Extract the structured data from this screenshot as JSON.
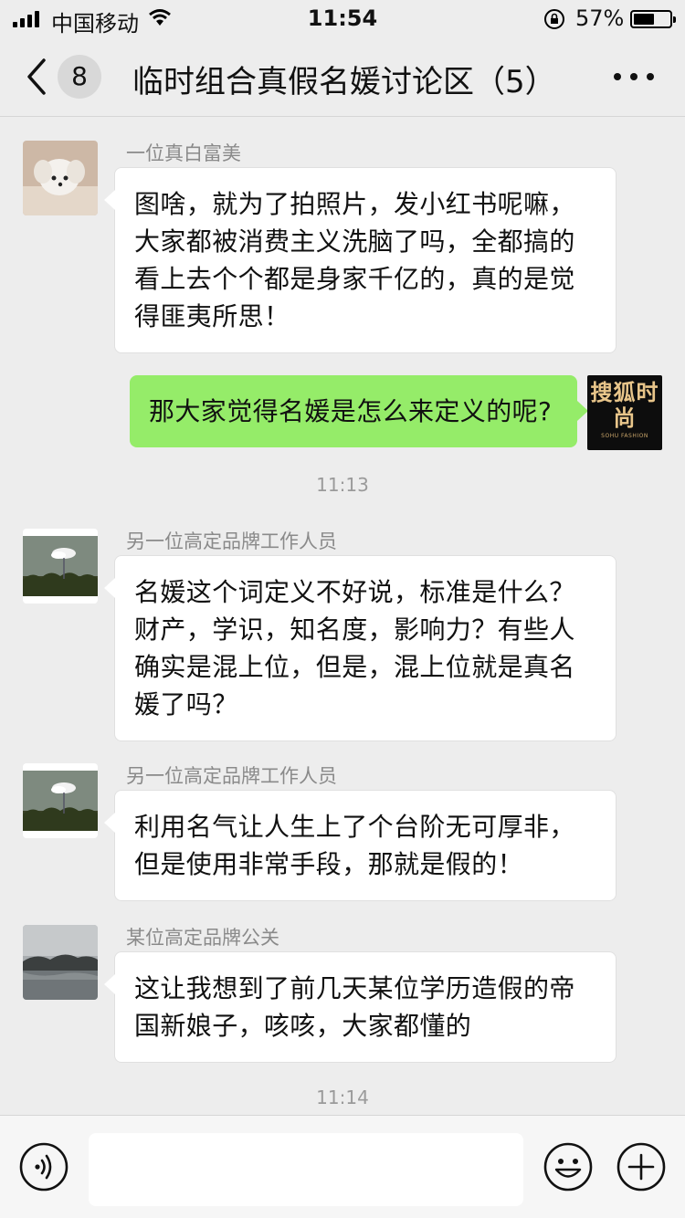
{
  "status_bar": {
    "carrier": "中国移动",
    "time": "11:54",
    "battery_text": "57%",
    "battery_level": 0.57
  },
  "header": {
    "unread_count": "8",
    "title": "临时组合真假名媛讨论区（5）"
  },
  "messages": [
    {
      "direction": "in",
      "sender": "一位真白富美",
      "avatar": "dog-avatar",
      "text": "图啥，就为了拍照片，发小红书呢嘛，大家都被消费主义洗脑了吗，全都搞的看上去个个都是身家千亿的，真的是觉得匪夷所思！"
    },
    {
      "direction": "out",
      "avatar_text": "搜狐时尚",
      "avatar_subtext": "SOHU FASHION",
      "text": "那大家觉得名媛是怎么来定义的呢?"
    },
    {
      "type": "time",
      "text": "11:13"
    },
    {
      "direction": "in",
      "sender": "另一位高定品牌工作人员",
      "avatar": "tree-cloud-avatar",
      "text": "名媛这个词定义不好说，标准是什么？财产，学识，知名度，影响力？有些人确实是混上位，但是，混上位就是真名媛了吗？"
    },
    {
      "direction": "in",
      "sender": "另一位高定品牌工作人员",
      "avatar": "tree-cloud-avatar",
      "text": "利用名气让人生上了个台阶无可厚非，但是使用非常手段，那就是假的！"
    },
    {
      "direction": "in",
      "sender": "某位高定品牌公关",
      "avatar": "lake-mountain-avatar",
      "text": "这让我想到了前几天某位学历造假的帝国新娘子，咳咳，大家都懂的"
    },
    {
      "type": "time",
      "text": "11:14"
    }
  ],
  "input_bar": {
    "value": ""
  }
}
